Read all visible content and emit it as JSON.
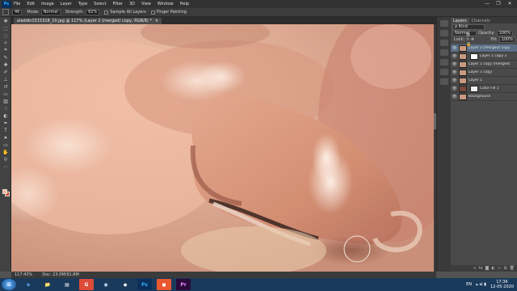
{
  "app": {
    "logo": "Ps"
  },
  "menu": [
    "File",
    "Edit",
    "Image",
    "Layer",
    "Type",
    "Select",
    "Filter",
    "3D",
    "View",
    "Window",
    "Help"
  ],
  "window_controls": [
    "—",
    "❐",
    "✕"
  ],
  "options": {
    "brush_size": "46",
    "mode_label": "Mode:",
    "mode_value": "Normal",
    "strength_label": "Strength:",
    "strength_value": "82%",
    "sample_all_layers": "Sample All Layers",
    "finger_painting": "Finger Painting"
  },
  "document": {
    "tab_title": "aladdin1515318_10.jpg @ 117% (Layer 2 (merged) copy, RGB/8) *",
    "close": "×"
  },
  "status": {
    "zoom": "117.43%",
    "doc": "Doc: 23.0M/91.8M"
  },
  "layers_panel": {
    "tabs": [
      "Layers",
      "Channels"
    ],
    "filter_label": "ρ Kind",
    "blend_mode": "Normal",
    "opacity_label": "Opacity:",
    "opacity_value": "100%",
    "lock_label": "Lock:",
    "fill_label": "Fill:",
    "fill_value": "100%",
    "layers": [
      {
        "name": "Layer 2 (merged) copy",
        "selected": true,
        "thumb": "skin"
      },
      {
        "name": "Layer 1 copy 2",
        "selected": false,
        "thumb": "mask"
      },
      {
        "name": "Layer 1 copy (merged)",
        "selected": false,
        "thumb": "skin"
      },
      {
        "name": "Layer 1 copy",
        "selected": false,
        "thumb": "skin"
      },
      {
        "name": "Layer 1",
        "selected": false,
        "thumb": "skin"
      },
      {
        "name": "Color Fill 1",
        "selected": false,
        "thumb": "white"
      },
      {
        "name": "Background",
        "selected": false,
        "thumb": "skin"
      }
    ]
  },
  "taskbar": {
    "apps": [
      "e",
      "📁",
      "▤",
      "G",
      "◉",
      "◆",
      "Ps",
      "◼",
      "Pr"
    ],
    "lang": "EN",
    "time": "17:36",
    "date": "12-05-2020"
  },
  "colors": {
    "foreground": "#f1b59a",
    "background": "#c84a2a",
    "accent": "#31a8ff"
  }
}
